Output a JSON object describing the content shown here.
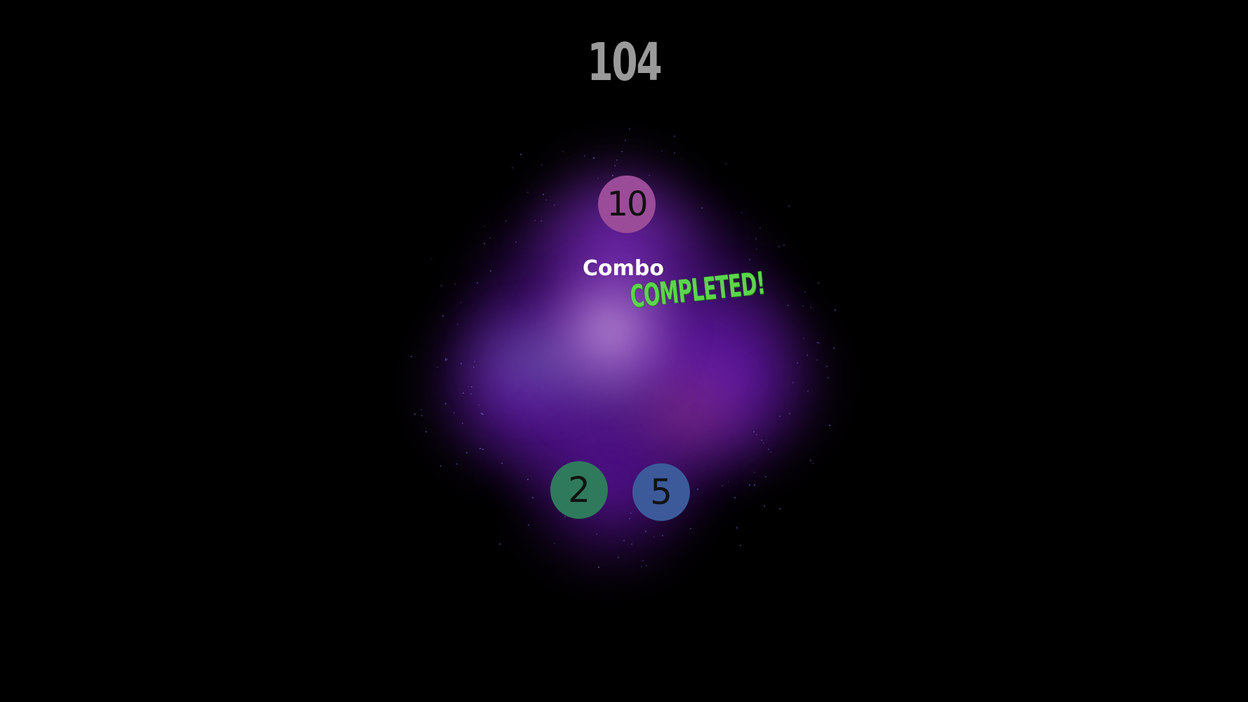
{
  "hud": {
    "score": "104"
  },
  "balls": {
    "top": {
      "value": "10",
      "color": "#9b4c99"
    },
    "left": {
      "value": "2",
      "color": "#2f7a5c"
    },
    "right": {
      "value": "5",
      "color": "#3c5a9a"
    }
  },
  "combo": {
    "label": "Combo",
    "status": "COMPLETED!",
    "status_color": "#5bd64c"
  },
  "background": {
    "color": "#000000",
    "nebula_color": "#7a2cc4"
  }
}
